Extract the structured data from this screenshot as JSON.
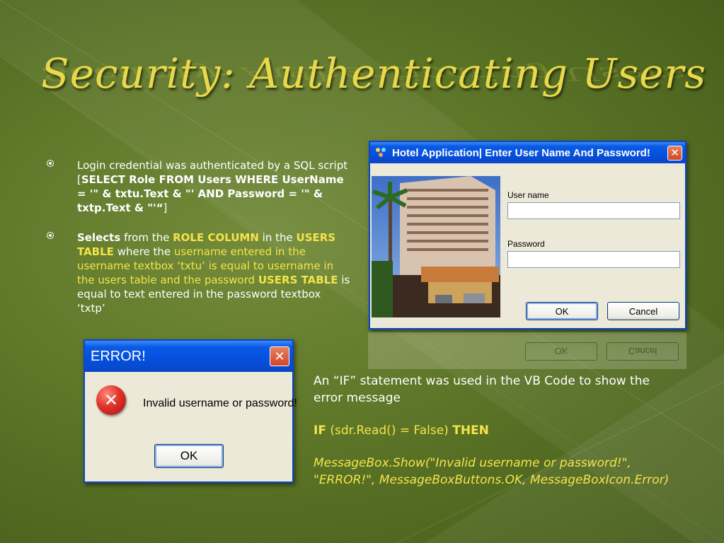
{
  "slide": {
    "title": "Security: Authenticating Users",
    "bullets": [
      {
        "lead": "Login credential was authenticated by a SQL script [",
        "sql": "SELECT Role FROM Users WHERE UserName = '\" & txtu.Text & \"' AND Password = '\" & txtp.Text & \"'“",
        "tail": "]"
      },
      {
        "w1": "Selects",
        "t1": " from the ",
        "w2": "ROLE COLUMN",
        "t2": " in the ",
        "w3": "USERS TABLE",
        "t3": " where the ",
        "y1": "username entered in the username textbox ‘txtu’ is equal to username in the users table and the password ",
        "w4": "USERS TABLE",
        "t4": " is equal to text entered in the password textbox ‘txtp’"
      }
    ],
    "code": {
      "intro": "An “IF” statement was used in the VB Code to show the error message",
      "if_kw": "IF",
      "if_cond": " (sdr.Read() = False) ",
      "then_kw": "THEN",
      "msgbox": "MessageBox.Show(\"Invalid username or password!\", \"ERROR!\", MessageBoxButtons.OK, MessageBoxIcon.Error)"
    }
  },
  "login_dialog": {
    "title": "Hotel Application| Enter User Name And Password!",
    "username_label": "User name",
    "password_label": "Password",
    "username_value": "",
    "password_value": "",
    "ok_label": "OK",
    "cancel_label": "Cancel",
    "close_glyph": "✕"
  },
  "error_dialog": {
    "title": "ERROR!",
    "message": "Invalid username or password!",
    "ok_label": "OK",
    "close_glyph": "✕",
    "icon_glyph": "✕"
  },
  "colors": {
    "accent_yellow": "#f4e44a",
    "xp_blue": "#0a5ae6",
    "error_red": "#d9241c"
  }
}
